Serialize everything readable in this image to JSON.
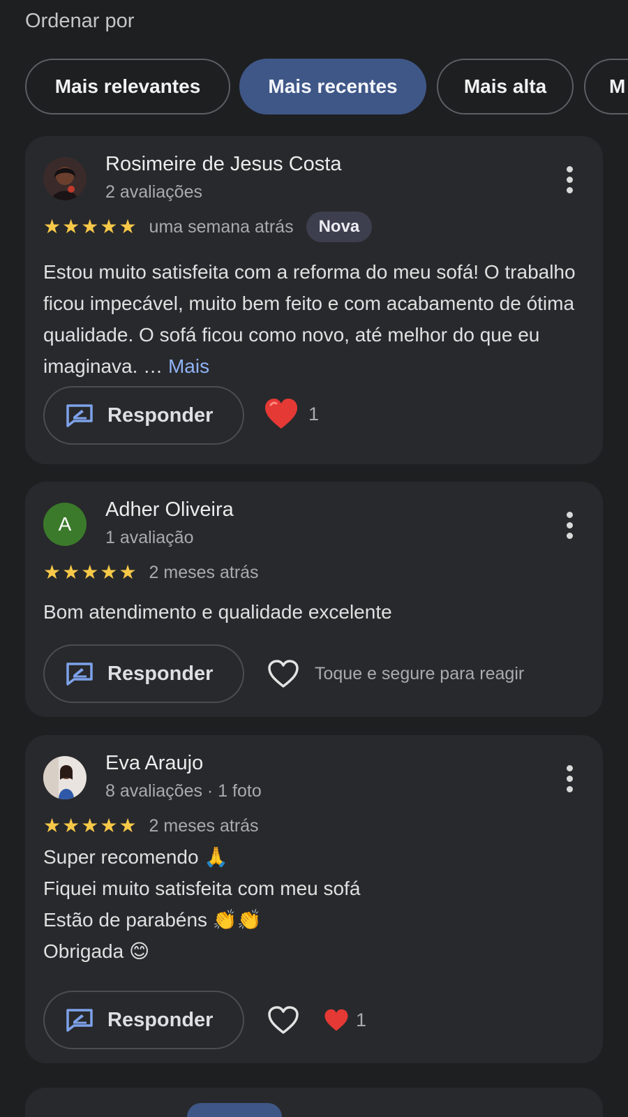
{
  "sort": {
    "label": "Ordenar por",
    "options": [
      "Mais relevantes",
      "Mais recentes",
      "Mais alta",
      "M"
    ],
    "selected": "Mais recentes"
  },
  "reviews": [
    {
      "name": "Rosimeire de Jesus Costa",
      "meta": "2 avaliações",
      "rating": 5,
      "time": "uma semana atrás",
      "badge": "Nova",
      "text": "Estou muito satisfeita com a reforma do meu sofá! O trabalho ficou impecável, muito bem feito e com acabamento de ótima qualidade. O sofá ficou como novo, até melhor do que eu imaginava. …",
      "more_link": "Mais",
      "reply_label": "Responder",
      "reaction_count": "1",
      "avatar": "profile-photo"
    },
    {
      "name": "Adher Oliveira",
      "meta": "1 avaliação",
      "rating": 5,
      "time": "2 meses atrás",
      "text": "Bom atendimento e qualidade excelente",
      "reply_label": "Responder",
      "reaction_hint": "Toque e segure para reagir",
      "avatar_letter": "A",
      "avatar_color": "#3b7a2b"
    },
    {
      "name": "Eva Araujo",
      "meta": "8 avaliações · 1 foto",
      "rating": 5,
      "time": "2 meses atrás",
      "text_lines": [
        "Super recomendo 🙏",
        "Fiquei muito satisfeita com meu sofá",
        "Estão de parabéns 👏👏",
        "Obrigada 😊"
      ],
      "reply_label": "Responder",
      "reaction_count": "1",
      "avatar": "profile-photo"
    }
  ],
  "colors": {
    "background": "#1e1f21",
    "card": "#28292c",
    "accent_chip": "#3f5787",
    "star": "#f7c948",
    "link": "#8fb3f5",
    "heart": "#e53935"
  },
  "icons": [
    "more-vert-icon",
    "reply-icon",
    "heart-filled-icon",
    "heart-outline-icon",
    "star-icon"
  ]
}
